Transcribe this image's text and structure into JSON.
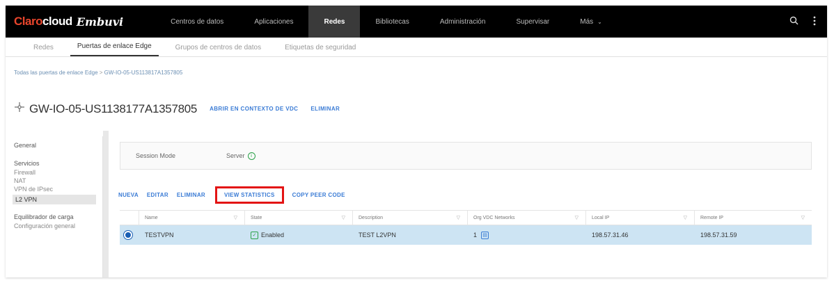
{
  "brand": {
    "name_accent": "Claro",
    "name_rest": "cloud",
    "product": "Embuvi"
  },
  "topnav": {
    "items": [
      {
        "label": "Centros de datos",
        "active": false
      },
      {
        "label": "Aplicaciones",
        "active": false
      },
      {
        "label": "Redes",
        "active": true
      },
      {
        "label": "Bibliotecas",
        "active": false
      },
      {
        "label": "Administración",
        "active": false
      },
      {
        "label": "Supervisar",
        "active": false
      },
      {
        "label": "Más",
        "active": false
      }
    ],
    "more_chevron": "⌄",
    "icons": [
      "search-icon",
      "more-vertical-icon"
    ]
  },
  "subtabs": [
    {
      "label": "Redes",
      "active": false
    },
    {
      "label": "Puertas de enlace Edge",
      "active": true
    },
    {
      "label": "Grupos de centros de datos",
      "active": false
    },
    {
      "label": "Etiquetas de seguridad",
      "active": false
    }
  ],
  "breadcrumb": {
    "parent": "Todas las puertas de enlace Edge",
    "separator": ">",
    "current": "GW-IO-05-US113817A1357805"
  },
  "header": {
    "title": "GW-IO-05-US1138177A1357805",
    "actions": [
      "ABRIR EN CONTEXTO DE VDC",
      "ELIMINAR"
    ]
  },
  "sidebar": {
    "general": "General",
    "services_heading": "Servicios",
    "services": [
      "Firewall",
      "NAT",
      "VPN de IPsec",
      "L2 VPN"
    ],
    "active_service": "L2 VPN",
    "lb_heading": "Equilibrador de carga",
    "lb_items": [
      "Configuración general"
    ]
  },
  "session_mode": {
    "label": "Session Mode",
    "value": "Server",
    "info": "i"
  },
  "actions": {
    "new": "NUEVA",
    "edit": "EDITAR",
    "delete": "ELIMINAR",
    "stats": "VIEW STATISTICS",
    "copy": "COPY PEER CODE"
  },
  "table": {
    "columns": [
      "Name",
      "State",
      "Description",
      "Org VDC Networks",
      "Local IP",
      "Remote IP"
    ],
    "filter_glyph": "▽",
    "rows": [
      {
        "name": "TESTVPN",
        "state": "Enabled",
        "state_glyph": "✓",
        "description": "TEST L2VPN",
        "org_vdc_networks": "1",
        "network_glyph": "▤",
        "local_ip": "198.57.31.46",
        "remote_ip": "198.57.31.59"
      }
    ]
  },
  "colors": {
    "accent": "#3a7bd5",
    "selected_row": "#cde4f3",
    "highlight_border": "#e31414",
    "topnav": "#000000"
  }
}
